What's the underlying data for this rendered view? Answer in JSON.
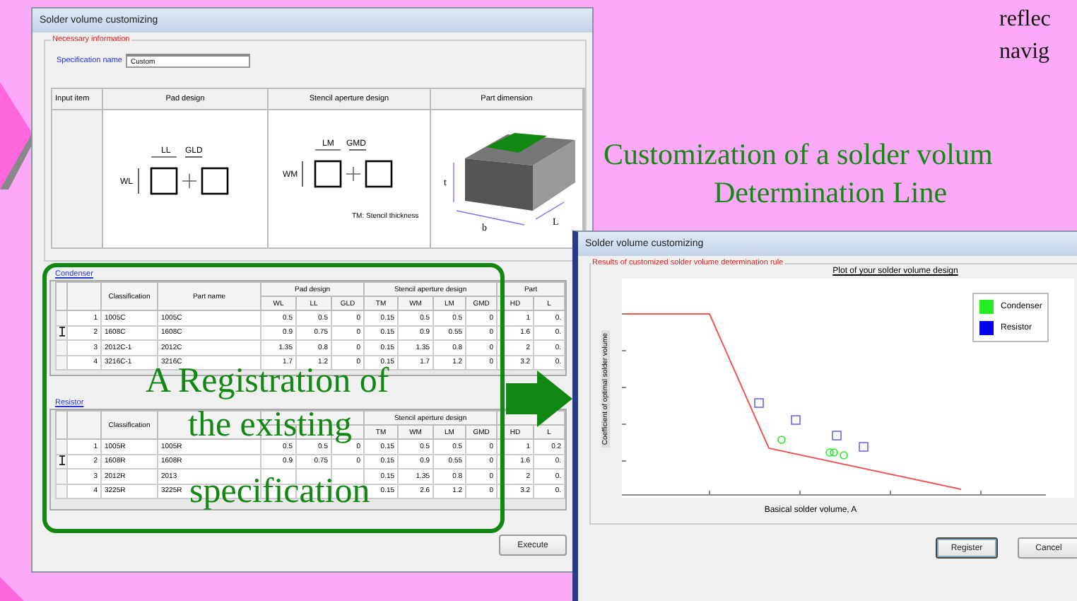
{
  "slide": {
    "side_text": [
      "reflec",
      "navig"
    ],
    "caption": [
      "Customization of a solder volum",
      "Determination Line"
    ],
    "callout": [
      "A Registration of",
      "the existing",
      "specification"
    ]
  },
  "main_window": {
    "title": "Solder volume customizing",
    "group_label": "Necessary information",
    "spec_label": "Specification name",
    "spec_value": "Custom",
    "input_table": {
      "columns": [
        "Input item",
        "Pad design",
        "Stencil aperture design",
        "Part dimension"
      ],
      "pad_labels": [
        "LL",
        "GLD",
        "WL"
      ],
      "stencil_labels": [
        "LM",
        "GMD",
        "WM"
      ],
      "stencil_note": "TM: Stencil thickness",
      "part_labels": [
        "t",
        "b",
        "L"
      ]
    },
    "sections": [
      {
        "label": "Condenser",
        "groups": [
          {
            "kind": "pad",
            "label": "Pad design"
          },
          {
            "kind": "stencil",
            "label": "Stencil aperture design"
          },
          {
            "kind": "part",
            "label": "Part"
          }
        ],
        "columns": [
          "Classification",
          "Part name",
          "WL",
          "LL",
          "GLD",
          "TM",
          "WM",
          "LM",
          "GMD",
          "HD",
          "L"
        ],
        "rows": [
          {
            "no": "1",
            "cells": [
              "1005C",
              "1005C",
              "0.5",
              "0.5",
              "0",
              "0.15",
              "0.5",
              "0.5",
              "0",
              "1",
              "0."
            ],
            "current": false
          },
          {
            "no": "2",
            "cells": [
              "1608C",
              "1608C",
              "0.9",
              "0.75",
              "0",
              "0.15",
              "0.9",
              "0.55",
              "0",
              "1.6",
              "0."
            ],
            "current": true
          },
          {
            "no": "3",
            "cells": [
              "2012C-1",
              "2012C",
              "1.35",
              "0.8",
              "0",
              "0.15",
              "1.35",
              "0.8",
              "0",
              "2",
              "0."
            ],
            "current": false
          },
          {
            "no": "4",
            "cells": [
              "3216C-1",
              "3216C",
              "1.7",
              "1.2",
              "0",
              "0.15",
              "1.7",
              "1.2",
              "0",
              "3.2",
              "0."
            ],
            "current": false
          }
        ]
      },
      {
        "label": "Resistor",
        "groups": [
          {
            "kind": "stencil",
            "label": "Stencil aperture design"
          }
        ],
        "columns": [
          "Classification",
          null,
          null,
          null,
          null,
          "TM",
          "WM",
          "LM",
          "GMD",
          "HD",
          "L"
        ],
        "rows": [
          {
            "no": "1",
            "cells": [
              "1005R",
              "1005R",
              "0.5",
              "0.5",
              "0",
              "0.15",
              "0.5",
              "0.5",
              "0",
              "1",
              "0.2"
            ],
            "current": false
          },
          {
            "no": "2",
            "cells": [
              "1608R",
              "1608R",
              "0.9",
              "0.75",
              "0",
              "0.15",
              "0.9",
              "0.55",
              "0",
              "1.6",
              "0."
            ],
            "current": true
          },
          {
            "no": "3",
            "cells": [
              "2012R",
              "2013",
              null,
              null,
              null,
              "0.15",
              "1.35",
              "0.8",
              "0",
              "2",
              "0."
            ],
            "current": false
          },
          {
            "no": "4",
            "cells": [
              "3225R",
              "3225R",
              null,
              null,
              null,
              "0.15",
              "2.6",
              "1.2",
              "0",
              "3.2",
              "0."
            ],
            "current": false
          }
        ]
      }
    ],
    "execute": "Execute"
  },
  "result_window": {
    "title": "Solder volume customizing",
    "group_label": "Results of customized solder volume determination rule",
    "chart_title": "Plot of your solder volume design",
    "y_label": "Coefficient of optimal solder volume",
    "x_label": "Basical solder volume, A",
    "legend": [
      {
        "label": "Condenser",
        "color": "#22ee22"
      },
      {
        "label": "Resistor",
        "color": "#0000ee"
      }
    ],
    "buttons": [
      {
        "label": "Register",
        "default": true
      },
      {
        "label": "Cancel",
        "default": false
      }
    ]
  }
}
